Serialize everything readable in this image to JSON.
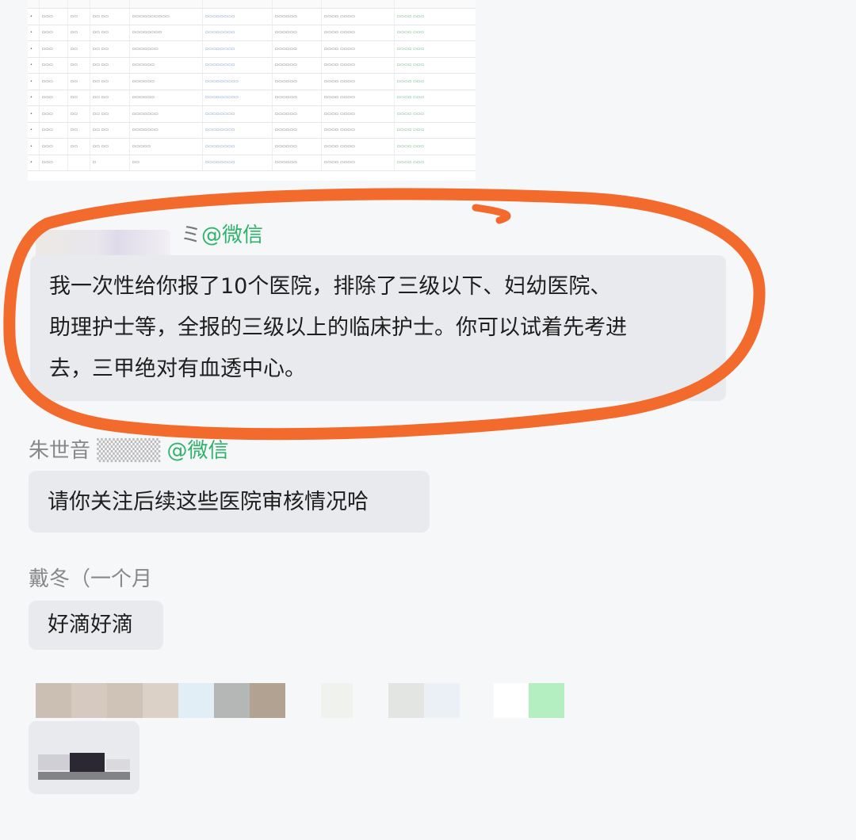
{
  "chat": {
    "messages": [
      {
        "sender_suffix": "@微信",
        "text_lines": [
          "我一次性给你报了10个医院，排除了三级以下、妇幼医院、",
          "助理护士等，全报的三级以上的临床护士。你可以试着先考进",
          "去，三甲绝对有血透中心。"
        ]
      },
      {
        "sender_name": "朱世音",
        "sender_suffix": "@微信",
        "text": "请你关注后续这些医院审核情况哈"
      },
      {
        "sender_name": "戴冬（一个月",
        "text": "好滴好滴"
      }
    ]
  },
  "highlight": {
    "color": "#f26a2c"
  }
}
